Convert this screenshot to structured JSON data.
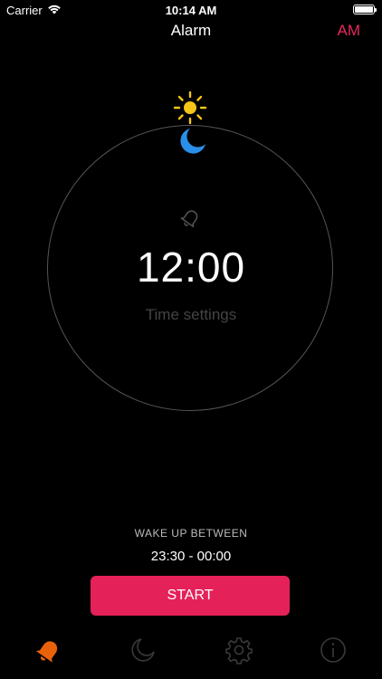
{
  "status_bar": {
    "carrier": "Carrier",
    "time": "10:14 AM"
  },
  "nav": {
    "title": "Alarm",
    "ampm_toggle": "AM"
  },
  "dial": {
    "time": "12:00",
    "subtitle": "Time settings"
  },
  "wake": {
    "label": "WAKE UP BETWEEN",
    "range": "23:30 - 00:00"
  },
  "start_button": {
    "label": "START"
  },
  "tabs": [
    {
      "icon": "alarm-bell-icon",
      "active": true
    },
    {
      "icon": "moon-icon",
      "active": false
    },
    {
      "icon": "gear-icon",
      "active": false
    },
    {
      "icon": "info-icon",
      "active": false
    }
  ],
  "colors": {
    "accent": "#e5215a",
    "tab_active": "#e8620c",
    "sun": "#f5c518",
    "moon": "#2a8fe8",
    "tab_inactive": "#3a3a3a"
  }
}
